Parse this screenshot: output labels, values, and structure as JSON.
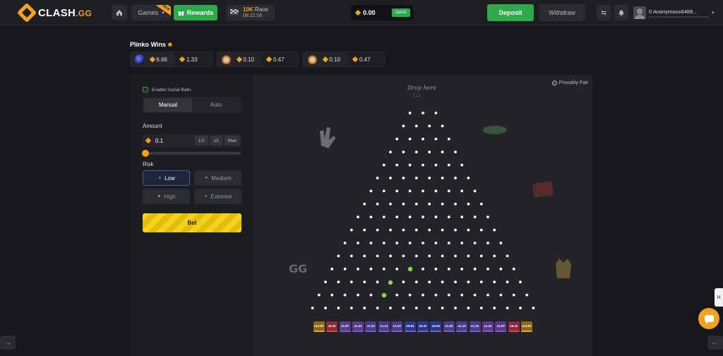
{
  "header": {
    "logo": "CLASH",
    "logo_suffix": ".GG",
    "games_label": "Games",
    "games_tag": "NEW",
    "rewards_label": "Rewards",
    "race_amount": "10K",
    "race_label": "Race",
    "race_timer": "08:22:06",
    "balance": "0.00",
    "balance_tag": "Gems",
    "deposit_label": "Deposit",
    "withdraw_label": "Withdraw",
    "username": "0 Anonymous6488..."
  },
  "wins": {
    "title": "Plinko Wins",
    "cards": [
      {
        "bet": "6.66",
        "payout": "1.33"
      },
      {
        "bet": "0.10",
        "payout": "0.47"
      },
      {
        "bet": "0.10",
        "payout": "0.47"
      }
    ]
  },
  "controls": {
    "social_label": "Enable Social Balls",
    "tab_manual": "Manual",
    "tab_auto": "Auto",
    "amount_label": "Amount",
    "amount_value": "0.1",
    "half_label": "1/2",
    "double_label": "x2",
    "max_label": "Max",
    "risk_label": "Risk",
    "risk_low": "Low",
    "risk_medium": "Medium",
    "risk_high": "High",
    "risk_extreme": "Extreme",
    "selected_risk": "Low",
    "bet_label": "Bet"
  },
  "board": {
    "provably_fair": "Provably Fair",
    "drop_here": "Drop here",
    "rows": 16,
    "multipliers": [
      "x14.87",
      "x5.42",
      "x1.87",
      "x1.31",
      "x1.31",
      "x1.12",
      "x1.03",
      "x0.94",
      "x0.47",
      "x0.94",
      "x1.03",
      "x1.12",
      "x1.31",
      "x1.31",
      "x1.87",
      "x5.42",
      "x14.87"
    ]
  },
  "colors": {
    "accent": "#f2a122",
    "green": "#2faa4a",
    "bet_yellow": "#f5d21c",
    "peg": "#ffffff",
    "ball": "#8fd14f"
  }
}
